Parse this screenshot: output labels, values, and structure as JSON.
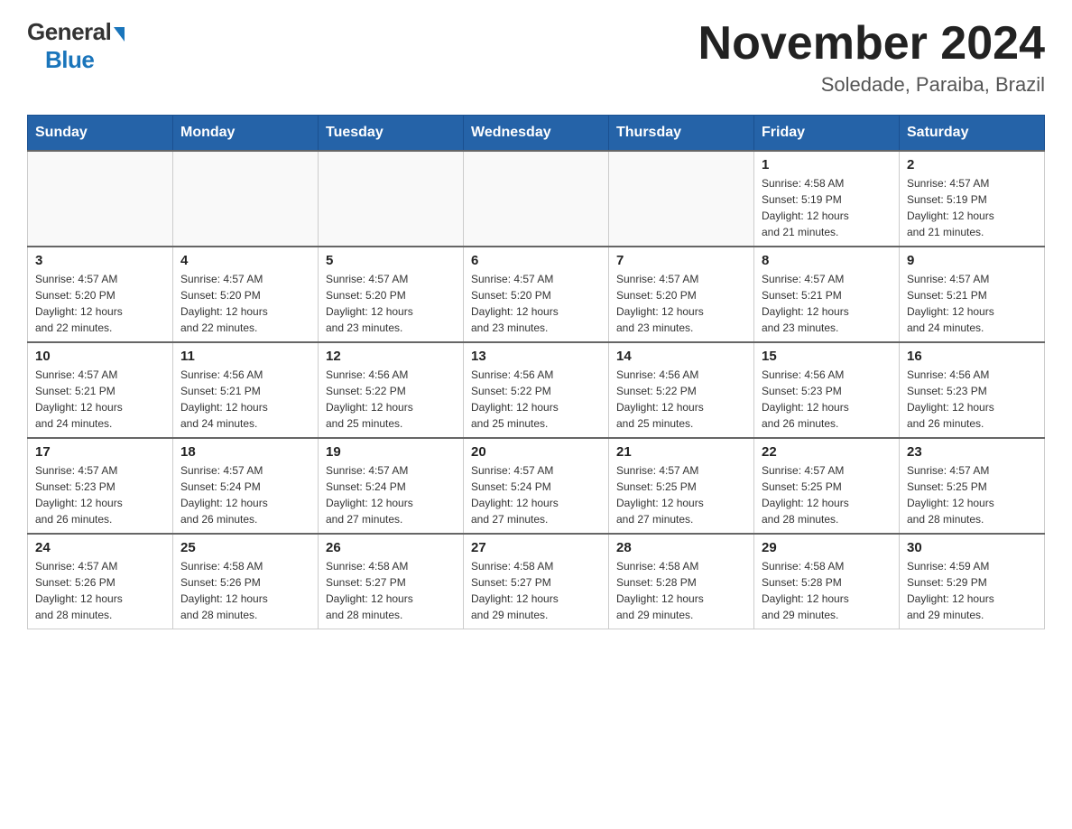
{
  "header": {
    "logo_general": "General",
    "logo_blue": "Blue",
    "month_title": "November 2024",
    "subtitle": "Soledade, Paraiba, Brazil"
  },
  "calendar": {
    "days_of_week": [
      "Sunday",
      "Monday",
      "Tuesday",
      "Wednesday",
      "Thursday",
      "Friday",
      "Saturday"
    ],
    "weeks": [
      [
        {
          "day": "",
          "info": ""
        },
        {
          "day": "",
          "info": ""
        },
        {
          "day": "",
          "info": ""
        },
        {
          "day": "",
          "info": ""
        },
        {
          "day": "",
          "info": ""
        },
        {
          "day": "1",
          "info": "Sunrise: 4:58 AM\nSunset: 5:19 PM\nDaylight: 12 hours\nand 21 minutes."
        },
        {
          "day": "2",
          "info": "Sunrise: 4:57 AM\nSunset: 5:19 PM\nDaylight: 12 hours\nand 21 minutes."
        }
      ],
      [
        {
          "day": "3",
          "info": "Sunrise: 4:57 AM\nSunset: 5:20 PM\nDaylight: 12 hours\nand 22 minutes."
        },
        {
          "day": "4",
          "info": "Sunrise: 4:57 AM\nSunset: 5:20 PM\nDaylight: 12 hours\nand 22 minutes."
        },
        {
          "day": "5",
          "info": "Sunrise: 4:57 AM\nSunset: 5:20 PM\nDaylight: 12 hours\nand 23 minutes."
        },
        {
          "day": "6",
          "info": "Sunrise: 4:57 AM\nSunset: 5:20 PM\nDaylight: 12 hours\nand 23 minutes."
        },
        {
          "day": "7",
          "info": "Sunrise: 4:57 AM\nSunset: 5:20 PM\nDaylight: 12 hours\nand 23 minutes."
        },
        {
          "day": "8",
          "info": "Sunrise: 4:57 AM\nSunset: 5:21 PM\nDaylight: 12 hours\nand 23 minutes."
        },
        {
          "day": "9",
          "info": "Sunrise: 4:57 AM\nSunset: 5:21 PM\nDaylight: 12 hours\nand 24 minutes."
        }
      ],
      [
        {
          "day": "10",
          "info": "Sunrise: 4:57 AM\nSunset: 5:21 PM\nDaylight: 12 hours\nand 24 minutes."
        },
        {
          "day": "11",
          "info": "Sunrise: 4:56 AM\nSunset: 5:21 PM\nDaylight: 12 hours\nand 24 minutes."
        },
        {
          "day": "12",
          "info": "Sunrise: 4:56 AM\nSunset: 5:22 PM\nDaylight: 12 hours\nand 25 minutes."
        },
        {
          "day": "13",
          "info": "Sunrise: 4:56 AM\nSunset: 5:22 PM\nDaylight: 12 hours\nand 25 minutes."
        },
        {
          "day": "14",
          "info": "Sunrise: 4:56 AM\nSunset: 5:22 PM\nDaylight: 12 hours\nand 25 minutes."
        },
        {
          "day": "15",
          "info": "Sunrise: 4:56 AM\nSunset: 5:23 PM\nDaylight: 12 hours\nand 26 minutes."
        },
        {
          "day": "16",
          "info": "Sunrise: 4:56 AM\nSunset: 5:23 PM\nDaylight: 12 hours\nand 26 minutes."
        }
      ],
      [
        {
          "day": "17",
          "info": "Sunrise: 4:57 AM\nSunset: 5:23 PM\nDaylight: 12 hours\nand 26 minutes."
        },
        {
          "day": "18",
          "info": "Sunrise: 4:57 AM\nSunset: 5:24 PM\nDaylight: 12 hours\nand 26 minutes."
        },
        {
          "day": "19",
          "info": "Sunrise: 4:57 AM\nSunset: 5:24 PM\nDaylight: 12 hours\nand 27 minutes."
        },
        {
          "day": "20",
          "info": "Sunrise: 4:57 AM\nSunset: 5:24 PM\nDaylight: 12 hours\nand 27 minutes."
        },
        {
          "day": "21",
          "info": "Sunrise: 4:57 AM\nSunset: 5:25 PM\nDaylight: 12 hours\nand 27 minutes."
        },
        {
          "day": "22",
          "info": "Sunrise: 4:57 AM\nSunset: 5:25 PM\nDaylight: 12 hours\nand 28 minutes."
        },
        {
          "day": "23",
          "info": "Sunrise: 4:57 AM\nSunset: 5:25 PM\nDaylight: 12 hours\nand 28 minutes."
        }
      ],
      [
        {
          "day": "24",
          "info": "Sunrise: 4:57 AM\nSunset: 5:26 PM\nDaylight: 12 hours\nand 28 minutes."
        },
        {
          "day": "25",
          "info": "Sunrise: 4:58 AM\nSunset: 5:26 PM\nDaylight: 12 hours\nand 28 minutes."
        },
        {
          "day": "26",
          "info": "Sunrise: 4:58 AM\nSunset: 5:27 PM\nDaylight: 12 hours\nand 28 minutes."
        },
        {
          "day": "27",
          "info": "Sunrise: 4:58 AM\nSunset: 5:27 PM\nDaylight: 12 hours\nand 29 minutes."
        },
        {
          "day": "28",
          "info": "Sunrise: 4:58 AM\nSunset: 5:28 PM\nDaylight: 12 hours\nand 29 minutes."
        },
        {
          "day": "29",
          "info": "Sunrise: 4:58 AM\nSunset: 5:28 PM\nDaylight: 12 hours\nand 29 minutes."
        },
        {
          "day": "30",
          "info": "Sunrise: 4:59 AM\nSunset: 5:29 PM\nDaylight: 12 hours\nand 29 minutes."
        }
      ]
    ]
  }
}
